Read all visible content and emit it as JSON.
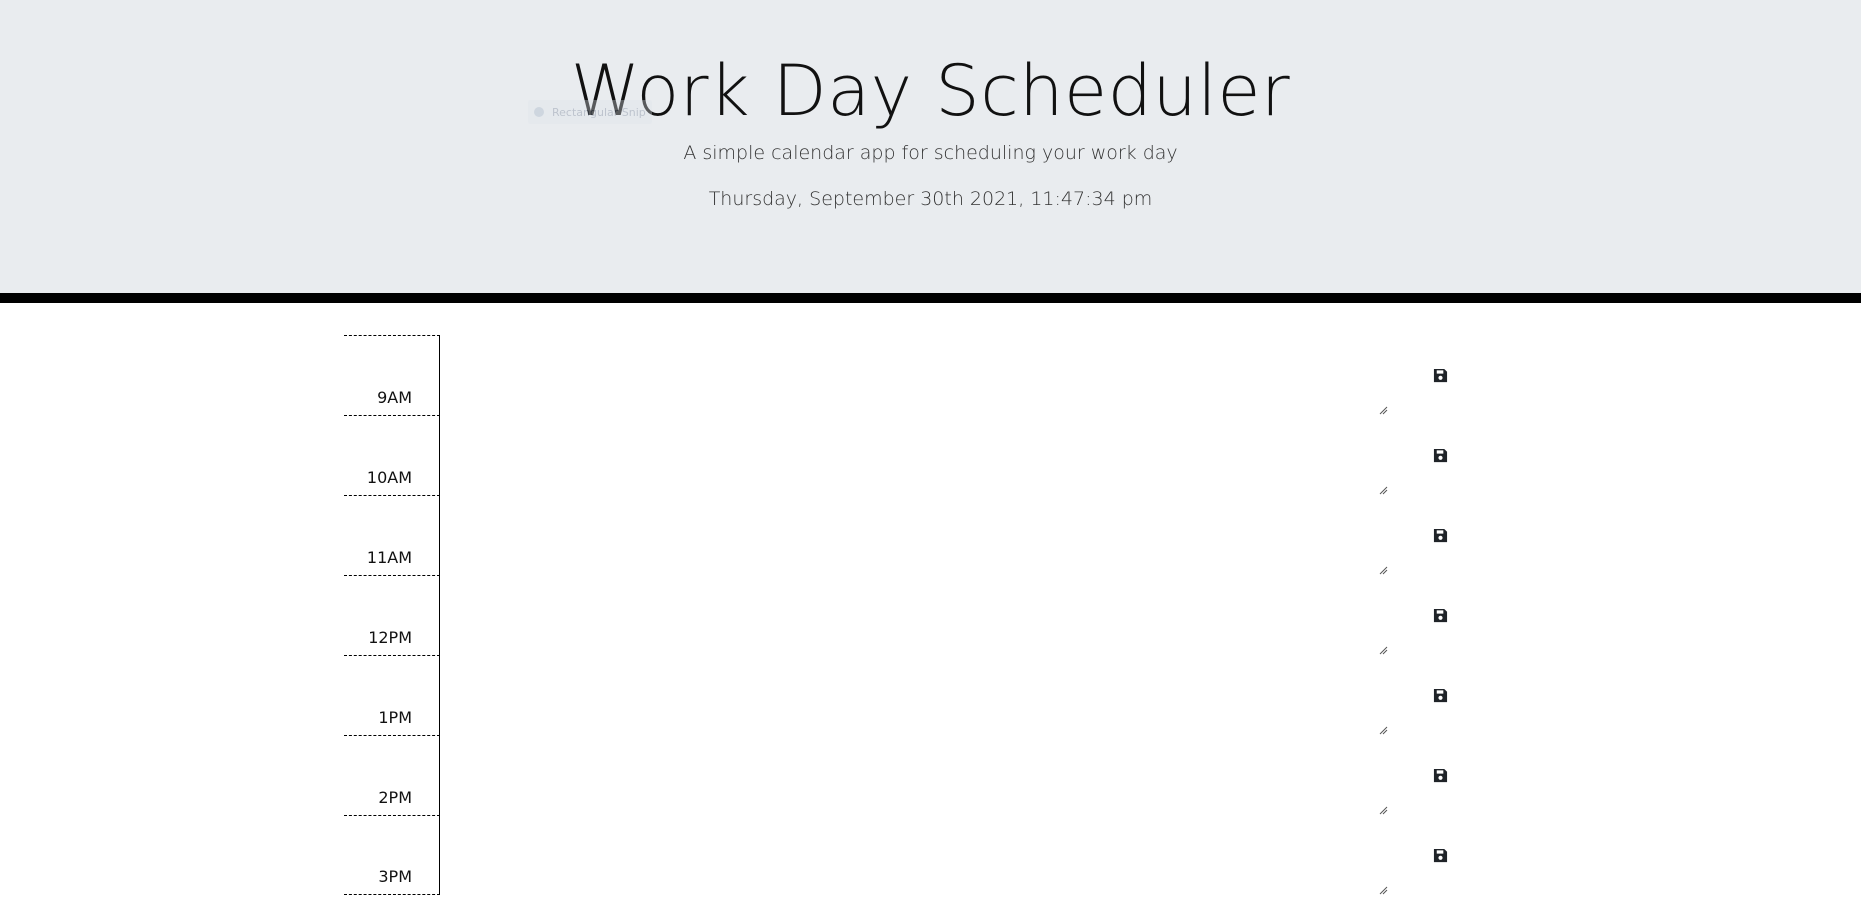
{
  "header": {
    "title": "Work Day Scheduler",
    "subtitle": "A simple calendar app for scheduling your work day",
    "current_datetime": "Thursday, September 30th 2021, 11:47:34 pm"
  },
  "overlay_chip": {
    "label": "Rectangular Snip",
    "icon": "snip-icon"
  },
  "colors": {
    "header_background": "#e9ecef",
    "divider": "#000000",
    "text": "#212529"
  },
  "schedule": {
    "save_icon": "floppy-disk-icon",
    "hours": [
      {
        "label": "9AM",
        "value": ""
      },
      {
        "label": "10AM",
        "value": ""
      },
      {
        "label": "11AM",
        "value": ""
      },
      {
        "label": "12PM",
        "value": ""
      },
      {
        "label": "1PM",
        "value": ""
      },
      {
        "label": "2PM",
        "value": ""
      },
      {
        "label": "3PM",
        "value": ""
      }
    ]
  }
}
